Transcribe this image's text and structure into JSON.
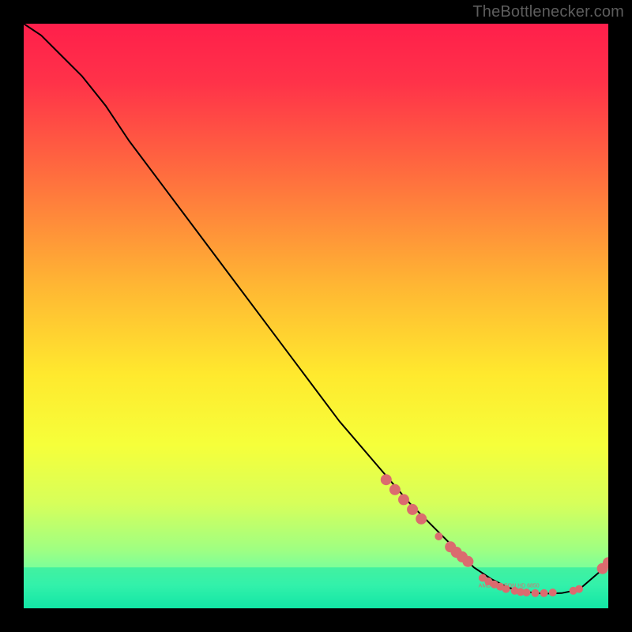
{
  "attribution": "TheBottlenecker.com",
  "chart_data": {
    "type": "line",
    "title": "",
    "xlabel": "",
    "ylabel": "",
    "xlim": [
      0,
      100
    ],
    "ylim": [
      0,
      100
    ],
    "grid": false,
    "legend": false,
    "background_gradient": {
      "stops": [
        {
          "offset": 0.0,
          "color": "#ff1f4b"
        },
        {
          "offset": 0.1,
          "color": "#ff3249"
        },
        {
          "offset": 0.25,
          "color": "#ff6a3f"
        },
        {
          "offset": 0.45,
          "color": "#ffb733"
        },
        {
          "offset": 0.6,
          "color": "#ffe92e"
        },
        {
          "offset": 0.72,
          "color": "#f6ff3a"
        },
        {
          "offset": 0.82,
          "color": "#d7ff5a"
        },
        {
          "offset": 0.9,
          "color": "#9fff82"
        },
        {
          "offset": 0.96,
          "color": "#5bffb0"
        },
        {
          "offset": 1.0,
          "color": "#12e6a5"
        }
      ]
    },
    "highlight_band": {
      "y0": 0,
      "y1": 7,
      "color": "#12e6a5"
    },
    "series": [
      {
        "name": "bottleneck-curve",
        "stroke": "#000000",
        "stroke_width": 2,
        "x": [
          0,
          3,
          6,
          10,
          14,
          18,
          24,
          30,
          36,
          42,
          48,
          54,
          60,
          66,
          71,
          74,
          77,
          80,
          83,
          86,
          89,
          92,
          95,
          98,
          100
        ],
        "y": [
          100,
          98,
          95,
          91,
          86,
          80,
          72,
          64,
          56,
          48,
          40,
          32,
          25,
          18,
          13,
          10,
          7,
          5,
          3.5,
          2.8,
          2.5,
          2.6,
          3.2,
          5.8,
          7.5
        ]
      }
    ],
    "markers": [
      {
        "name": "gpu-cluster-left",
        "color": "#db6b6f",
        "radius_large": 7,
        "radius_small": 5,
        "points": [
          {
            "x": 62,
            "y": 22,
            "r": "large"
          },
          {
            "x": 63.5,
            "y": 20.3,
            "r": "large"
          },
          {
            "x": 65,
            "y": 18.6,
            "r": "large"
          },
          {
            "x": 66.5,
            "y": 16.9,
            "r": "large"
          },
          {
            "x": 68,
            "y": 15.3,
            "r": "large"
          },
          {
            "x": 71,
            "y": 12.3,
            "r": "small"
          },
          {
            "x": 73,
            "y": 10.5,
            "r": "large"
          },
          {
            "x": 74,
            "y": 9.6,
            "r": "large"
          },
          {
            "x": 75,
            "y": 8.8,
            "r": "large"
          },
          {
            "x": 76,
            "y": 8.0,
            "r": "large"
          }
        ]
      },
      {
        "name": "gpu-cluster-bottom",
        "color": "#db6b6f",
        "radius_large": 7,
        "radius_small": 5,
        "label": {
          "text": "AMD RADEON HD 6850",
          "x_center": 83,
          "y": 3.8,
          "color": "#db6b6f",
          "font_size": 7
        },
        "points": [
          {
            "x": 78.5,
            "y": 5.2,
            "r": "small"
          },
          {
            "x": 79.5,
            "y": 4.6,
            "r": "small"
          },
          {
            "x": 80.5,
            "y": 4.1,
            "r": "small"
          },
          {
            "x": 81.5,
            "y": 3.7,
            "r": "small"
          },
          {
            "x": 82.5,
            "y": 3.3,
            "r": "small"
          },
          {
            "x": 84.0,
            "y": 3.0,
            "r": "small"
          },
          {
            "x": 85.0,
            "y": 2.8,
            "r": "small"
          },
          {
            "x": 86.0,
            "y": 2.7,
            "r": "small"
          },
          {
            "x": 87.5,
            "y": 2.6,
            "r": "small"
          },
          {
            "x": 89.0,
            "y": 2.6,
            "r": "small"
          },
          {
            "x": 90.5,
            "y": 2.7,
            "r": "small"
          },
          {
            "x": 94.0,
            "y": 3.0,
            "r": "small"
          },
          {
            "x": 95.0,
            "y": 3.3,
            "r": "small"
          },
          {
            "x": 99.0,
            "y": 6.8,
            "r": "large"
          },
          {
            "x": 100.0,
            "y": 7.8,
            "r": "large"
          }
        ]
      }
    ]
  }
}
